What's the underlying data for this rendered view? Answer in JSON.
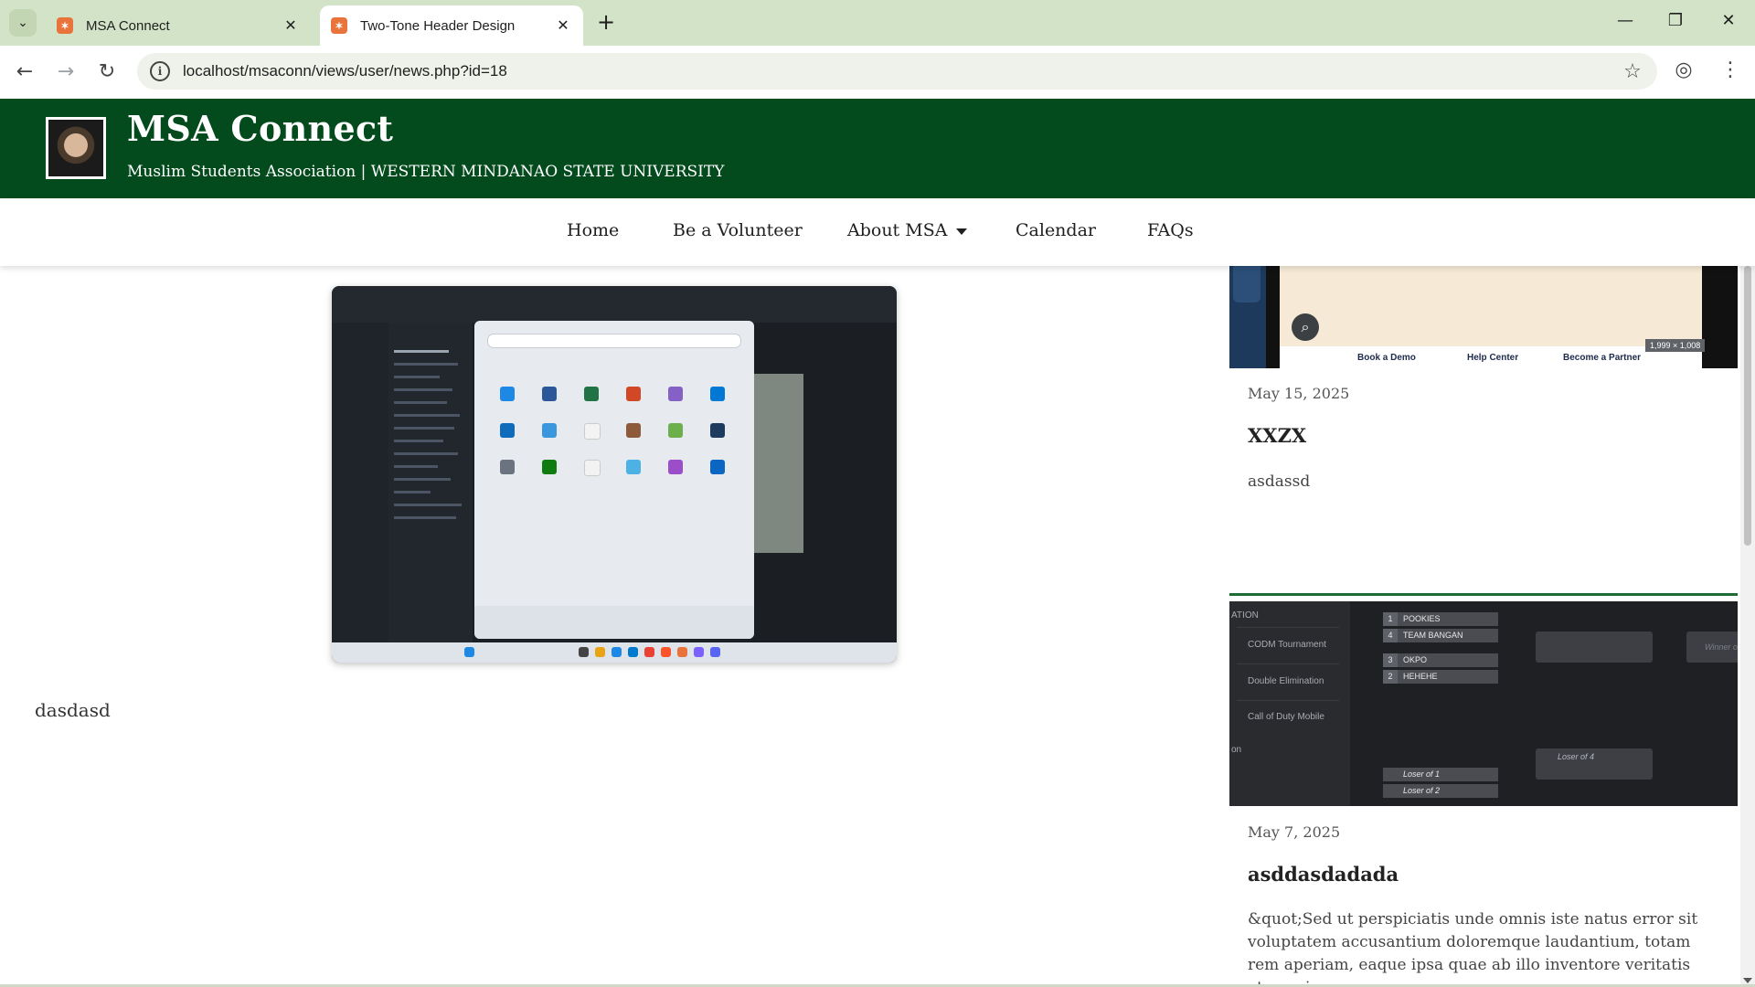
{
  "browser": {
    "tabs": [
      {
        "title": "MSA Connect",
        "active": false
      },
      {
        "title": "Two-Tone Header Design",
        "active": true
      }
    ],
    "url": "localhost/msaconn/views/user/news.php?id=18",
    "tab_close_glyph": "✕",
    "new_tab_glyph": "+",
    "window_controls": {
      "minimize": "—",
      "maximize": "❐",
      "close": "✕"
    }
  },
  "site": {
    "title": "MSA Connect",
    "subtitle": "Muslim Students Association | WESTERN MINDANAO STATE UNIVERSITY",
    "colors": {
      "header_green": "#034a1c",
      "separator_green": "#1f6b34"
    }
  },
  "nav": {
    "items": [
      {
        "label": "Home"
      },
      {
        "label": "Be a Volunteer"
      },
      {
        "label": "About MSA",
        "has_dropdown": true
      },
      {
        "label": "Calendar"
      },
      {
        "label": "FAQs"
      }
    ]
  },
  "article": {
    "body": "dasdasd"
  },
  "sidebar": {
    "cards": [
      {
        "date": "May 15, 2025",
        "title": "XXZX",
        "excerpt": "asdassd",
        "image_text": {
          "links": [
            "Book a Demo",
            "Help Center",
            "Become a Partner"
          ],
          "size_badge": "1,999 × 1,008"
        }
      },
      {
        "date": "May 7, 2025",
        "title": "asddasdadada",
        "excerpt": "&quot;Sed ut perspiciatis unde omnis iste natus error sit voluptatem accusantium doloremque laudantium, totam rem aperiam, eaque ipsa quae ab illo inventore veritatis et quasi",
        "image_text": {
          "menu": [
            "ATION",
            "CODM Tournament",
            "Double Elimination",
            "Call of Duty Mobile",
            "on"
          ],
          "teams": [
            {
              "seed": "1",
              "name": "POOKIES"
            },
            {
              "seed": "4",
              "name": "TEAM BANGAN"
            },
            {
              "seed": "3",
              "name": "OKPO"
            },
            {
              "seed": "2",
              "name": "HEHEHE"
            }
          ],
          "losers": [
            "Loser of 1",
            "Loser of 2",
            "Loser of 4"
          ],
          "winner_label": "Winner o"
        }
      }
    ]
  }
}
